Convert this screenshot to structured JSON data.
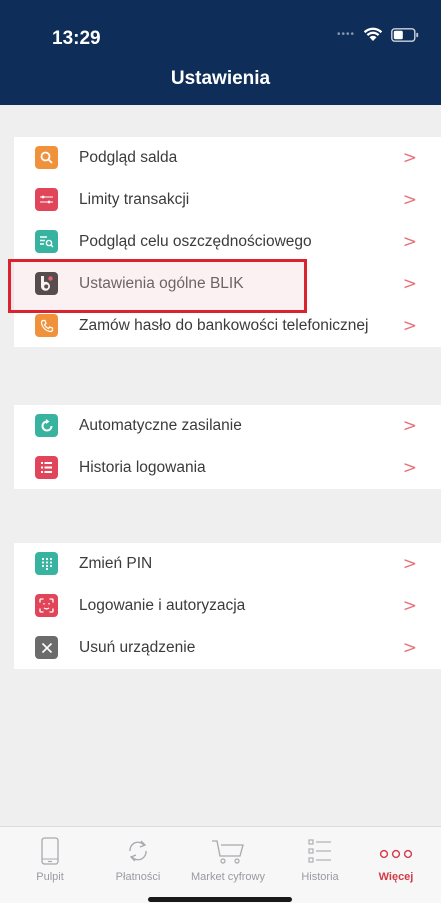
{
  "status_bar": {
    "time": "13:29"
  },
  "header": {
    "title": "Ustawienia"
  },
  "groups": [
    {
      "items": [
        {
          "label": "Podgląd salda",
          "icon": "search-icon",
          "color": "#f0923b",
          "chevron": ">"
        },
        {
          "label": "Limity transakcji",
          "icon": "sliders-icon",
          "color": "#e0455a",
          "chevron": ">"
        },
        {
          "label": "Podgląd celu oszczędnościowego",
          "icon": "savings-goal-icon",
          "color": "#37b3a0",
          "chevron": ">"
        },
        {
          "label": "Ustawienia ogólne BLIK",
          "icon": "blik-icon",
          "color": "#1b1b1b",
          "chevron": ">"
        },
        {
          "label": "Zamów hasło do bankowości telefonicznej",
          "icon": "phone-icon",
          "color": "#f0923b",
          "chevron": ">"
        }
      ]
    },
    {
      "items": [
        {
          "label": "Automatyczne zasilanie",
          "icon": "refresh-icon",
          "color": "#37b3a0",
          "chevron": ">"
        },
        {
          "label": "Historia logowania",
          "icon": "list-icon",
          "color": "#e0455a",
          "chevron": ">"
        }
      ]
    },
    {
      "items": [
        {
          "label": "Zmień PIN",
          "icon": "keypad-icon",
          "color": "#37b3a0",
          "chevron": ">"
        },
        {
          "label": "Logowanie i autoryzacja",
          "icon": "face-id-icon",
          "color": "#e0455a",
          "chevron": ">"
        },
        {
          "label": "Usuń urządzenie",
          "icon": "close-icon",
          "color": "#6b6b6b",
          "chevron": ">"
        }
      ]
    }
  ],
  "tabbar": {
    "tabs": [
      {
        "label": "Pulpit",
        "icon": "phone-device-icon",
        "active": false
      },
      {
        "label": "Płatności",
        "icon": "transfer-arrows-icon",
        "active": false
      },
      {
        "label": "Market cyfrowy",
        "icon": "cart-icon",
        "active": false
      },
      {
        "label": "Historia",
        "icon": "history-list-icon",
        "active": false
      },
      {
        "label": "Więcej",
        "icon": "more-dots-icon",
        "active": true
      }
    ],
    "active_color": "#d23a47"
  },
  "colors": {
    "header_bg": "#0e2d58",
    "chevron": "#e8707a",
    "highlight": "#d9232e"
  }
}
